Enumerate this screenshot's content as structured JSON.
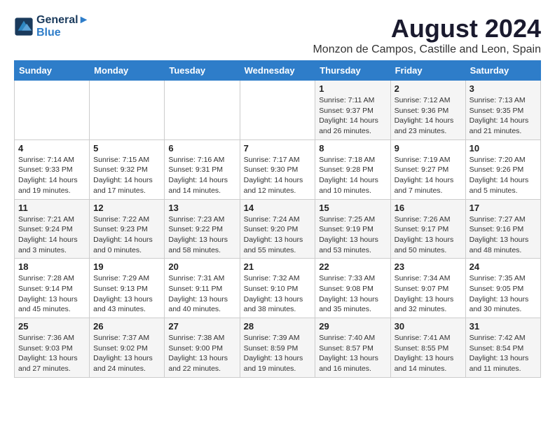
{
  "logo": {
    "line1": "General",
    "line2": "Blue"
  },
  "title": "August 2024",
  "subtitle": "Monzon de Campos, Castille and Leon, Spain",
  "days_of_week": [
    "Sunday",
    "Monday",
    "Tuesday",
    "Wednesday",
    "Thursday",
    "Friday",
    "Saturday"
  ],
  "weeks": [
    [
      {
        "day": "",
        "info": ""
      },
      {
        "day": "",
        "info": ""
      },
      {
        "day": "",
        "info": ""
      },
      {
        "day": "",
        "info": ""
      },
      {
        "day": "1",
        "info": "Sunrise: 7:11 AM\nSunset: 9:37 PM\nDaylight: 14 hours and 26 minutes."
      },
      {
        "day": "2",
        "info": "Sunrise: 7:12 AM\nSunset: 9:36 PM\nDaylight: 14 hours and 23 minutes."
      },
      {
        "day": "3",
        "info": "Sunrise: 7:13 AM\nSunset: 9:35 PM\nDaylight: 14 hours and 21 minutes."
      }
    ],
    [
      {
        "day": "4",
        "info": "Sunrise: 7:14 AM\nSunset: 9:33 PM\nDaylight: 14 hours and 19 minutes."
      },
      {
        "day": "5",
        "info": "Sunrise: 7:15 AM\nSunset: 9:32 PM\nDaylight: 14 hours and 17 minutes."
      },
      {
        "day": "6",
        "info": "Sunrise: 7:16 AM\nSunset: 9:31 PM\nDaylight: 14 hours and 14 minutes."
      },
      {
        "day": "7",
        "info": "Sunrise: 7:17 AM\nSunset: 9:30 PM\nDaylight: 14 hours and 12 minutes."
      },
      {
        "day": "8",
        "info": "Sunrise: 7:18 AM\nSunset: 9:28 PM\nDaylight: 14 hours and 10 minutes."
      },
      {
        "day": "9",
        "info": "Sunrise: 7:19 AM\nSunset: 9:27 PM\nDaylight: 14 hours and 7 minutes."
      },
      {
        "day": "10",
        "info": "Sunrise: 7:20 AM\nSunset: 9:26 PM\nDaylight: 14 hours and 5 minutes."
      }
    ],
    [
      {
        "day": "11",
        "info": "Sunrise: 7:21 AM\nSunset: 9:24 PM\nDaylight: 14 hours and 3 minutes."
      },
      {
        "day": "12",
        "info": "Sunrise: 7:22 AM\nSunset: 9:23 PM\nDaylight: 14 hours and 0 minutes."
      },
      {
        "day": "13",
        "info": "Sunrise: 7:23 AM\nSunset: 9:22 PM\nDaylight: 13 hours and 58 minutes."
      },
      {
        "day": "14",
        "info": "Sunrise: 7:24 AM\nSunset: 9:20 PM\nDaylight: 13 hours and 55 minutes."
      },
      {
        "day": "15",
        "info": "Sunrise: 7:25 AM\nSunset: 9:19 PM\nDaylight: 13 hours and 53 minutes."
      },
      {
        "day": "16",
        "info": "Sunrise: 7:26 AM\nSunset: 9:17 PM\nDaylight: 13 hours and 50 minutes."
      },
      {
        "day": "17",
        "info": "Sunrise: 7:27 AM\nSunset: 9:16 PM\nDaylight: 13 hours and 48 minutes."
      }
    ],
    [
      {
        "day": "18",
        "info": "Sunrise: 7:28 AM\nSunset: 9:14 PM\nDaylight: 13 hours and 45 minutes."
      },
      {
        "day": "19",
        "info": "Sunrise: 7:29 AM\nSunset: 9:13 PM\nDaylight: 13 hours and 43 minutes."
      },
      {
        "day": "20",
        "info": "Sunrise: 7:31 AM\nSunset: 9:11 PM\nDaylight: 13 hours and 40 minutes."
      },
      {
        "day": "21",
        "info": "Sunrise: 7:32 AM\nSunset: 9:10 PM\nDaylight: 13 hours and 38 minutes."
      },
      {
        "day": "22",
        "info": "Sunrise: 7:33 AM\nSunset: 9:08 PM\nDaylight: 13 hours and 35 minutes."
      },
      {
        "day": "23",
        "info": "Sunrise: 7:34 AM\nSunset: 9:07 PM\nDaylight: 13 hours and 32 minutes."
      },
      {
        "day": "24",
        "info": "Sunrise: 7:35 AM\nSunset: 9:05 PM\nDaylight: 13 hours and 30 minutes."
      }
    ],
    [
      {
        "day": "25",
        "info": "Sunrise: 7:36 AM\nSunset: 9:03 PM\nDaylight: 13 hours and 27 minutes."
      },
      {
        "day": "26",
        "info": "Sunrise: 7:37 AM\nSunset: 9:02 PM\nDaylight: 13 hours and 24 minutes."
      },
      {
        "day": "27",
        "info": "Sunrise: 7:38 AM\nSunset: 9:00 PM\nDaylight: 13 hours and 22 minutes."
      },
      {
        "day": "28",
        "info": "Sunrise: 7:39 AM\nSunset: 8:59 PM\nDaylight: 13 hours and 19 minutes."
      },
      {
        "day": "29",
        "info": "Sunrise: 7:40 AM\nSunset: 8:57 PM\nDaylight: 13 hours and 16 minutes."
      },
      {
        "day": "30",
        "info": "Sunrise: 7:41 AM\nSunset: 8:55 PM\nDaylight: 13 hours and 14 minutes."
      },
      {
        "day": "31",
        "info": "Sunrise: 7:42 AM\nSunset: 8:54 PM\nDaylight: 13 hours and 11 minutes."
      }
    ]
  ]
}
